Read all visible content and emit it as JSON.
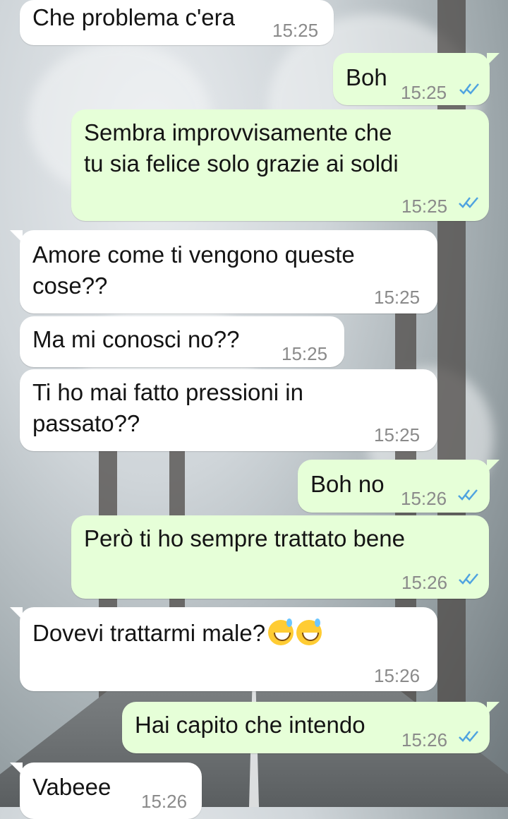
{
  "messages": [
    {
      "dir": "in",
      "text": "Che problema c'era",
      "time": "15:25"
    },
    {
      "dir": "out",
      "text": "Boh",
      "time": "15:25"
    },
    {
      "dir": "out",
      "lines": [
        "Sembra improvvisamente che",
        "tu sia felice solo grazie ai soldi"
      ],
      "time": "15:25"
    },
    {
      "dir": "in",
      "lines": [
        "Amore come ti vengono queste",
        "cose??"
      ],
      "time": "15:25"
    },
    {
      "dir": "in",
      "text": "Ma mi conosci no??",
      "time": "15:25"
    },
    {
      "dir": "in",
      "lines": [
        "Ti ho mai fatto pressioni in",
        "passato??"
      ],
      "time": "15:25"
    },
    {
      "dir": "out",
      "text": "Boh no",
      "time": "15:26"
    },
    {
      "dir": "out",
      "text": "Però ti ho sempre trattato bene",
      "time": "15:26"
    },
    {
      "dir": "in",
      "text": "Dovevi trattarmi male?",
      "emojis": [
        "grinning-face-with-sweat",
        "grinning-face-with-sweat"
      ],
      "time": "15:26"
    },
    {
      "dir": "out",
      "text": "Hai capito che intendo",
      "time": "15:26"
    },
    {
      "dir": "in",
      "text": "Vabeee",
      "time": "15:26"
    }
  ],
  "colors": {
    "incoming": "#ffffff",
    "outgoing": "#e6ffd8",
    "read_ticks": "#4fa3e0",
    "time": "#8a8a8a"
  }
}
